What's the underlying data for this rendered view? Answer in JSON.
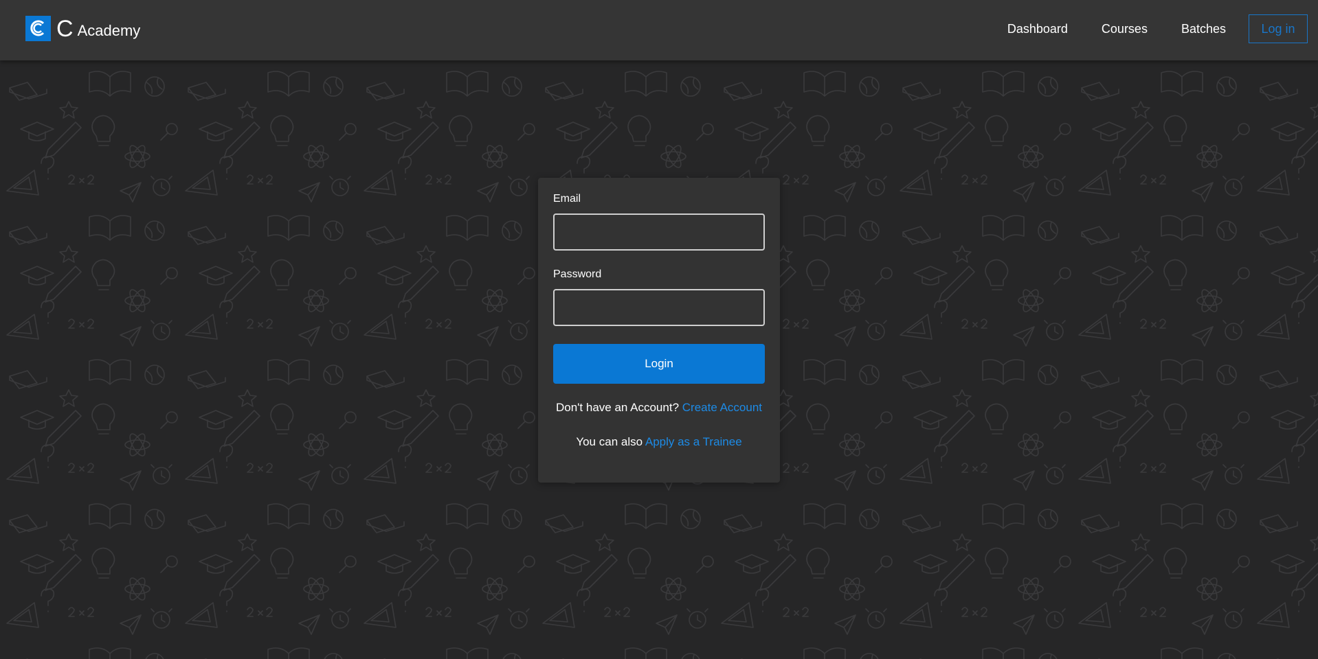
{
  "navbar": {
    "brand_letter": "C",
    "brand_name": "Academy",
    "links": [
      "Dashboard",
      "Courses",
      "Batches"
    ],
    "login_label": "Log in"
  },
  "form": {
    "email_label": "Email",
    "email_value": "",
    "password_label": "Password",
    "password_value": "",
    "login_button": "Login",
    "no_account_text": "Don't have an Account?",
    "create_account_link": "Create Account",
    "also_text": "You can also",
    "apply_link": "Apply as a Trainee"
  },
  "colors": {
    "accent": "#0a78d4",
    "navbar_bg": "#353535",
    "page_bg": "#262627",
    "card_bg": "#333333"
  },
  "icons": {
    "brand": "c-academy-logo-icon",
    "background": "school-doodle-pattern"
  }
}
